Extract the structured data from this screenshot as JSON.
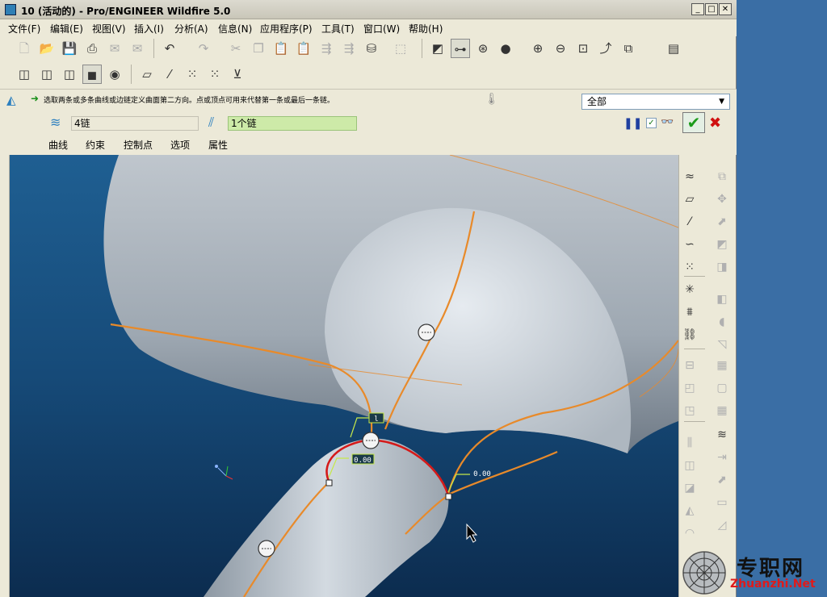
{
  "window": {
    "title": "10 (活动的) - Pro/ENGINEER Wildfire 5.0"
  },
  "menu": [
    "文件(F)",
    "编辑(E)",
    "视图(V)",
    "插入(I)",
    "分析(A)",
    "信息(N)",
    "应用程序(P)",
    "工具(T)",
    "窗口(W)",
    "帮助(H)"
  ],
  "dashboard": {
    "prompt": "选取两条或多条曲线或边链定义曲面第二方向。点或顶点可用来代替第一条或最后一条链。",
    "filter": "全部",
    "first_direction": "4链",
    "second_direction": "1个链",
    "tabs": [
      "曲线",
      "约束",
      "控制点",
      "选项",
      "属性"
    ]
  },
  "viewport": {
    "labels": [
      "0.00",
      "0.00"
    ],
    "colors": {
      "curve": "#e88a2a",
      "selected": "#d41a1a",
      "surface": "#c6ced6"
    }
  },
  "watermark": {
    "cn": "专职网",
    "en": "Zhuanzhi.Net"
  }
}
